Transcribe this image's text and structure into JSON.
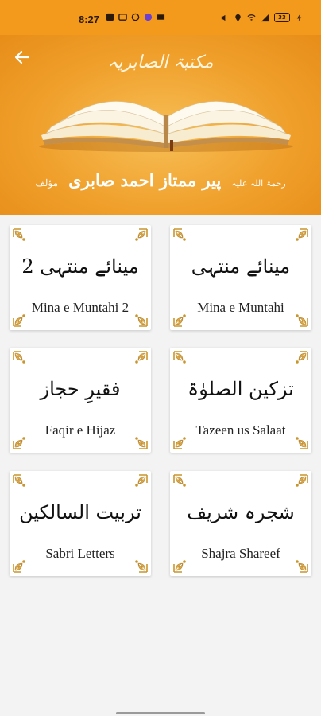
{
  "status_bar": {
    "time": "8:27",
    "battery": "33"
  },
  "header": {
    "logo_text": "مکتبۃ الصابریہ",
    "author_prefix": "مؤلف",
    "author_name": "پیر ممتاز احمد صابری",
    "author_suffix": "رحمۃ اللہ علیہ"
  },
  "books": [
    {
      "urdu": "مینائے منتہی 2",
      "english": "Mina e Muntahi 2"
    },
    {
      "urdu": "مینائے منتہی",
      "english": "Mina e Muntahi"
    },
    {
      "urdu": "فقیرِ حجاز",
      "english": "Faqir e Hijaz"
    },
    {
      "urdu": "تزکین الصلوٰۃ",
      "english": "Tazeen us Salaat"
    },
    {
      "urdu": "تربیت السالکین",
      "english": "Sabri Letters"
    },
    {
      "urdu": "شجرہ شریف",
      "english": "Shajra Shareef"
    }
  ],
  "colors": {
    "header_orange": "#f39a1d",
    "ornament_gold": "#c9962e"
  }
}
